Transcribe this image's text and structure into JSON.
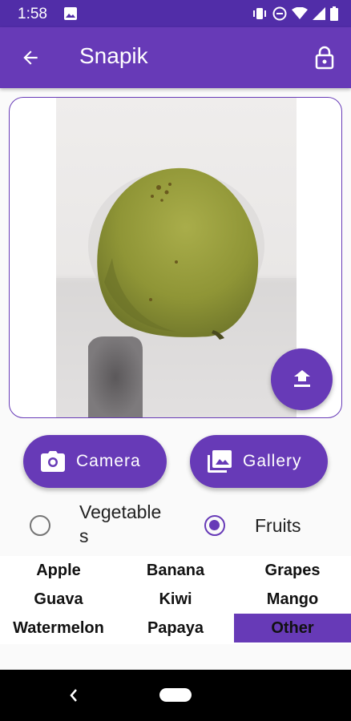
{
  "status_bar": {
    "time": "1:58"
  },
  "app_bar": {
    "title": "Snapik"
  },
  "buttons": {
    "camera": "Camera",
    "gallery": "Gallery"
  },
  "category": {
    "options": [
      {
        "label": "Vegetables",
        "selected": false
      },
      {
        "label": "Fruits",
        "selected": true
      }
    ]
  },
  "items": [
    "Apple",
    "Banana",
    "Grapes",
    "Guava",
    "Kiwi",
    "Mango",
    "Watermelon",
    "Papaya",
    "Other"
  ],
  "selected_item": "Other",
  "colors": {
    "primary": "#673ab7",
    "primary_dark": "#512da8"
  }
}
